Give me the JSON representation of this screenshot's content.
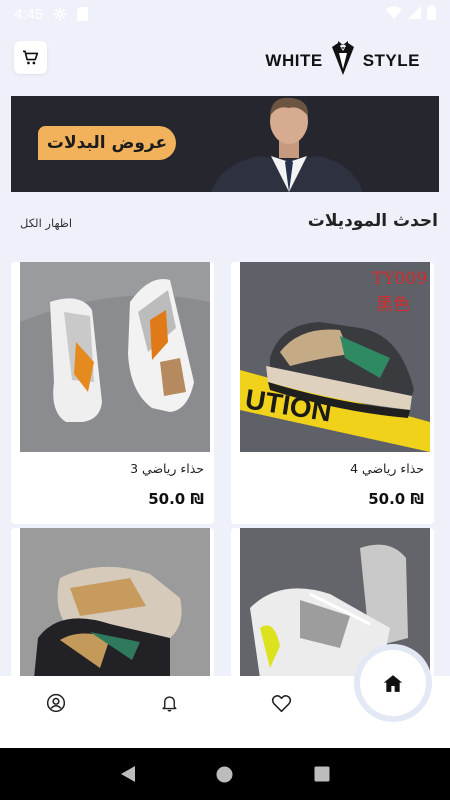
{
  "status": {
    "time": "4:45"
  },
  "header": {
    "logo_left": "WHITE",
    "logo_right": "STYLE"
  },
  "banner": {
    "label": "عروض البدلات"
  },
  "section": {
    "title": "احدث الموديلات",
    "show_all": "اظهار الكل"
  },
  "products": [
    {
      "name": "حذاء رياضي 4",
      "price": "50.0 ₪",
      "photo_text": [
        "TY009",
        "黑色"
      ],
      "photo_banner_text": "UTION"
    },
    {
      "name": "حذاء رياضي 3",
      "price": "50.0 ₪"
    },
    {
      "name": "",
      "price": ""
    },
    {
      "name": "",
      "price": ""
    }
  ],
  "nav": {
    "items": [
      "profile-icon",
      "bell-icon",
      "heart-icon",
      "home-icon"
    ],
    "active": "home"
  },
  "colors": {
    "background": "#eef1f9",
    "banner_tag": "#f2b25c",
    "banner_bg": "#26262e"
  }
}
